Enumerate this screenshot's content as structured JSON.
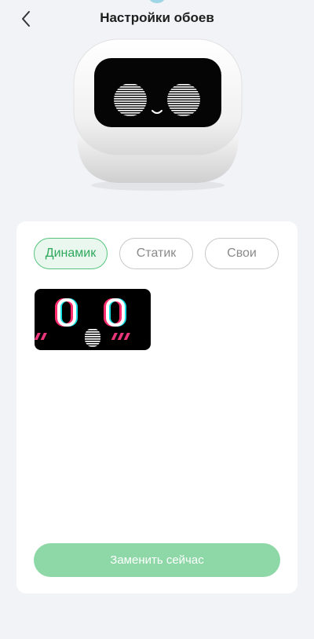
{
  "header": {
    "title": "Настройки обоев",
    "back_icon": "chevron-left-icon"
  },
  "tabs": [
    {
      "label": "Динамик",
      "active": true
    },
    {
      "label": "Статик",
      "active": false
    },
    {
      "label": "Свои",
      "active": false
    }
  ],
  "wallpapers": [
    {
      "name": "surprised-face",
      "selected": false
    }
  ],
  "actions": {
    "replace_label": "Заменить сейчас"
  },
  "colors": {
    "accent": "#2fa85c",
    "accent_bg": "#e9f7ee",
    "button_disabled": "#8ed8a7",
    "page_bg": "#f2f3f7"
  }
}
